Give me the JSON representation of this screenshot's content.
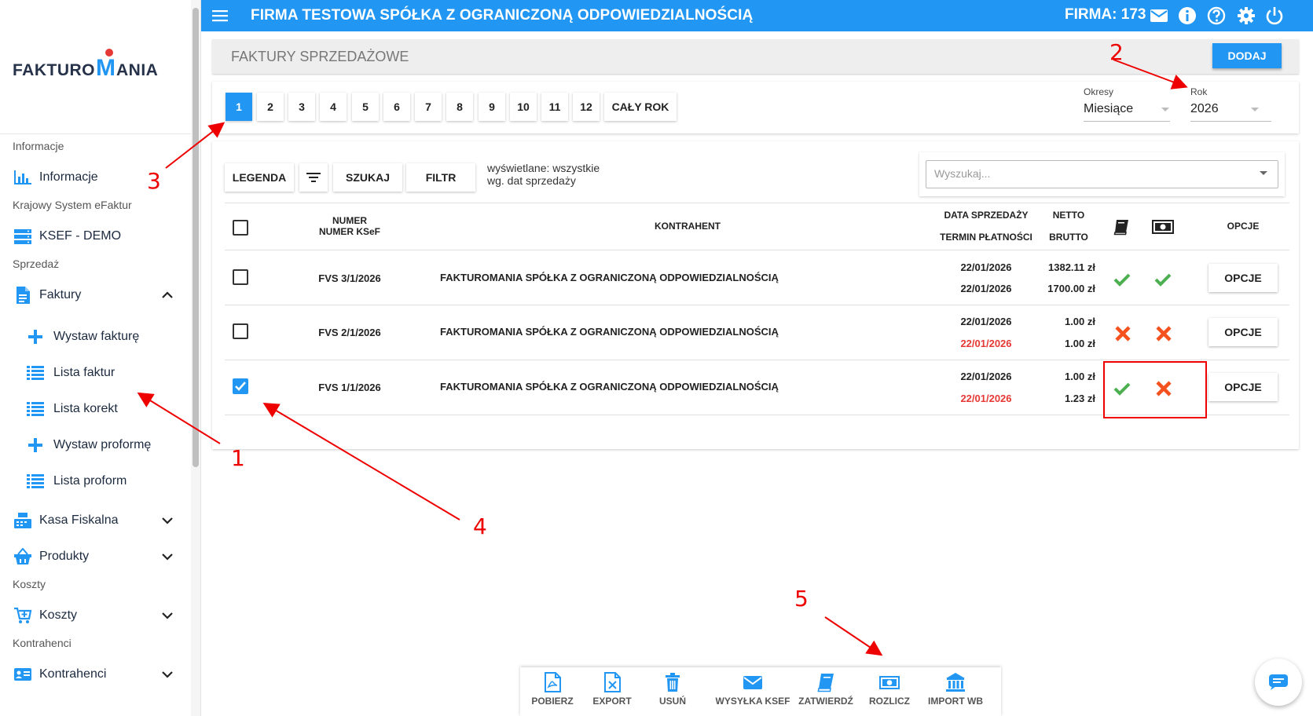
{
  "app": {
    "company_title": "FIRMA TESTOWA SPÓŁKA Z OGRANICZONĄ ODPOWIEDZIALNOŚCIĄ",
    "firma_label": "FIRMA: 173",
    "brand_color": "#2196f3",
    "logo_left": "FAKTURO",
    "logo_m": "M",
    "logo_right": "ANIA"
  },
  "sidebar": {
    "sections": [
      {
        "label": "Informacje"
      },
      {
        "label": "Krajowy System eFaktur"
      },
      {
        "label": "Sprzedaż"
      },
      {
        "label": "Koszty"
      },
      {
        "label": "Kontrahenci"
      }
    ],
    "items": {
      "informacje": "Informacje",
      "ksef": "KSEF - DEMO",
      "faktury": "Faktury",
      "wystaw_fakture": "Wystaw fakturę",
      "lista_faktur": "Lista faktur",
      "lista_korekt": "Lista korekt",
      "wystaw_proforme": "Wystaw proformę",
      "lista_proform": "Lista proform",
      "kasa_fiskalna": "Kasa Fiskalna",
      "produkty": "Produkty",
      "koszty": "Koszty",
      "kontrahenci": "Kontrahenci"
    }
  },
  "header": {
    "title": "FAKTURY SPRZEDAŻOWE",
    "add_button": "DODAJ"
  },
  "periods": {
    "months": [
      "1",
      "2",
      "3",
      "4",
      "5",
      "6",
      "7",
      "8",
      "9",
      "10",
      "11",
      "12"
    ],
    "active_month": "1",
    "whole_year": "CAŁY ROK",
    "okresy_label": "Okresy",
    "okresy_value": "Miesiące",
    "rok_label": "Rok",
    "rok_value": "2026"
  },
  "toolbar": {
    "legenda": "LEGENDA",
    "filter_icon": "filter-icon",
    "szukaj": "SZUKAJ",
    "filtr": "FILTR",
    "info_line1": "wyświetlane: wszystkie",
    "info_line2": "wg. dat sprzedaży",
    "search_placeholder": "Wyszukaj..."
  },
  "table": {
    "headers": {
      "numer": "NUMER",
      "numer_ksef": "NUMER KSeF",
      "kontrahent": "KONTRAHENT",
      "data_sprzedazy": "DATA SPRZEDAŻY",
      "termin_platnosci": "TERMIN PŁATNOŚCI",
      "netto": "NETTO",
      "brutto": "BRUTTO",
      "book_icon": "book-icon",
      "money_icon": "money-icon",
      "opcje": "OPCJE"
    },
    "rows": [
      {
        "numer": "FVS 3/1/2026",
        "kontrahent": "FAKTUROMANIA SPÓŁKA Z OGRANICZONĄ ODPOWIEDZIALNOŚCIĄ",
        "data_sprzedazy": "22/01/2026",
        "termin": "22/01/2026",
        "termin_overdue": false,
        "netto": "1382.11 zł",
        "brutto": "1700.00 zł",
        "zatwierdzona": true,
        "rozliczona": true,
        "checked": false,
        "opcje": "OPCJE"
      },
      {
        "numer": "FVS 2/1/2026",
        "kontrahent": "FAKTUROMANIA SPÓŁKA Z OGRANICZONĄ ODPOWIEDZIALNOŚCIĄ",
        "data_sprzedazy": "22/01/2026",
        "termin": "22/01/2026",
        "termin_overdue": true,
        "netto": "1.00 zł",
        "brutto": "1.00 zł",
        "zatwierdzona": false,
        "rozliczona": false,
        "checked": false,
        "opcje": "OPCJE"
      },
      {
        "numer": "FVS 1/1/2026",
        "kontrahent": "FAKTUROMANIA SPÓŁKA Z OGRANICZONĄ ODPOWIEDZIALNOŚCIĄ",
        "data_sprzedazy": "22/01/2026",
        "termin": "22/01/2026",
        "termin_overdue": true,
        "netto": "1.00 zł",
        "brutto": "1.23 zł",
        "zatwierdzona": true,
        "rozliczona": false,
        "checked": true,
        "opcje": "OPCJE"
      }
    ]
  },
  "bottom_actions": [
    {
      "label": "POBIERZ",
      "icon": "pdf-icon"
    },
    {
      "label": "EXPORT",
      "icon": "excel-icon"
    },
    {
      "label": "USUŃ",
      "icon": "trash-icon"
    },
    {
      "label": "WYSYŁKA KSEF",
      "icon": "envelope-icon"
    },
    {
      "label": "ZATWIERDŹ",
      "icon": "book-icon"
    },
    {
      "label": "ROZLICZ",
      "icon": "money-icon"
    },
    {
      "label": "IMPORT WB",
      "icon": "bank-icon"
    }
  ],
  "annotations": [
    "1",
    "2",
    "3",
    "4",
    "5"
  ],
  "colors": {
    "accent": "#2196f3",
    "ok": "#4caf50",
    "error": "#f4511e",
    "annotation": "#e00000"
  }
}
